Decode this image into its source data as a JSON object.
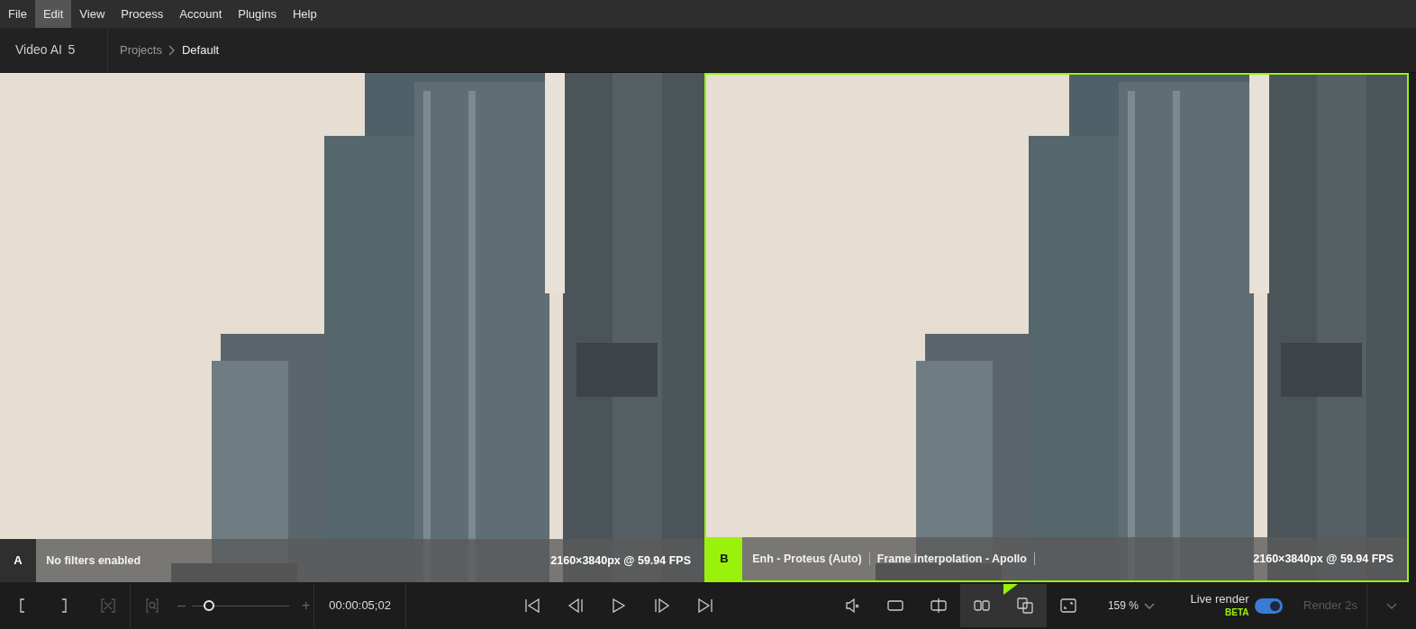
{
  "menu": [
    {
      "label": "File",
      "selected": false
    },
    {
      "label": "Edit",
      "selected": true
    },
    {
      "label": "View",
      "selected": false
    },
    {
      "label": "Process",
      "selected": false
    },
    {
      "label": "Account",
      "selected": false
    },
    {
      "label": "Plugins",
      "selected": false
    },
    {
      "label": "Help",
      "selected": false
    }
  ],
  "app": {
    "name": "Video AI",
    "version": "5"
  },
  "breadcrumb": [
    "Projects",
    "Default"
  ],
  "panes": [
    {
      "letter": "A",
      "selected": false,
      "filters": [
        "No filters enabled"
      ],
      "info": "2160×3840px @ 59.94 FPS"
    },
    {
      "letter": "B",
      "selected": true,
      "filters": [
        "Enh - Proteus (Auto)",
        "Frame interpolation -  Apollo"
      ],
      "info": "2160×3840px @ 59.94 FPS"
    }
  ],
  "toolbar": {
    "clear_marks_disabled": true,
    "zoom_fit_disabled": true,
    "timeline_zoom": {
      "level": 0.13,
      "minus": "–",
      "plus": "+"
    },
    "timecode": "00:00:05;02",
    "view_modes": [
      {
        "kind": "single",
        "selected": false
      },
      {
        "kind": "split",
        "selected": false
      },
      {
        "kind": "side",
        "selected": true
      },
      {
        "kind": "ab",
        "selected": true
      }
    ],
    "zoom": "159 %",
    "live_render": {
      "label": "Live render",
      "badge": "BETA",
      "on": true
    },
    "render": {
      "label": "Render 2s",
      "disabled": true
    }
  }
}
